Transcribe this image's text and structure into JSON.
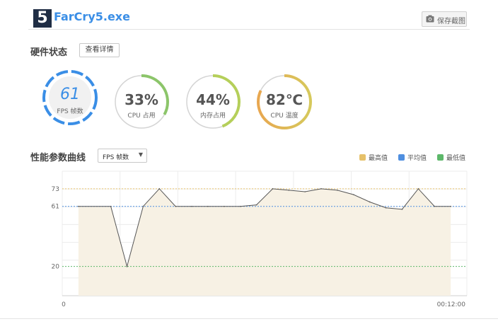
{
  "app": {
    "logo_text": "5",
    "title": "FarCry5.exe"
  },
  "toolbar": {
    "screenshot_label": "保存截图"
  },
  "hardware": {
    "title": "硬件状态",
    "detail_button": "查看详情"
  },
  "gauges": [
    {
      "id": "fps",
      "value": "61",
      "label": "FPS 帧数",
      "fraction": 1.0,
      "color": "#3a8ee6"
    },
    {
      "id": "cpu",
      "value": "33%",
      "label": "CPU 占用",
      "fraction": 0.33,
      "color": "#8cc56a"
    },
    {
      "id": "mem",
      "value": "44%",
      "label": "内存占用",
      "fraction": 0.44,
      "color": "#b5cf5a"
    },
    {
      "id": "temp",
      "value": "82℃",
      "label": "CPU 温度",
      "fraction": 0.82,
      "color": "#e5b95a"
    }
  ],
  "performance": {
    "title": "性能参数曲线",
    "metric_select": "FPS 帧数",
    "legend": [
      {
        "label": "最高值",
        "color": "#e6c16a"
      },
      {
        "label": "平均值",
        "color": "#4f8fe0"
      },
      {
        "label": "最低值",
        "color": "#5db86a"
      }
    ]
  },
  "chart_data": {
    "type": "area",
    "x_start_label": "0",
    "x_end_label": "00:12:00",
    "x": [
      0.5,
      1.5,
      2.0,
      2.5,
      3.0,
      3.5,
      4.0,
      4.5,
      5.0,
      5.5,
      6.0,
      6.5,
      7.0,
      7.5,
      8.0,
      8.5,
      9.0,
      9.5,
      10.0,
      10.5,
      11.0,
      11.5,
      12.0
    ],
    "values": [
      61,
      61,
      20,
      61,
      73,
      61,
      61,
      61,
      61,
      61,
      62,
      73,
      72,
      71,
      73,
      72,
      69,
      64,
      60,
      59,
      73,
      61,
      61
    ],
    "reference_lines": [
      {
        "name": "最高值",
        "value": 73,
        "color": "#e6c16a"
      },
      {
        "name": "平均值",
        "value": 61,
        "color": "#4f8fe0"
      },
      {
        "name": "最低值",
        "value": 20,
        "color": "#5db86a"
      }
    ],
    "y_tick_labels": [
      "73",
      "61",
      "20"
    ],
    "ylim": [
      0,
      85
    ],
    "xlim": [
      0,
      12.5
    ],
    "grid": true
  }
}
